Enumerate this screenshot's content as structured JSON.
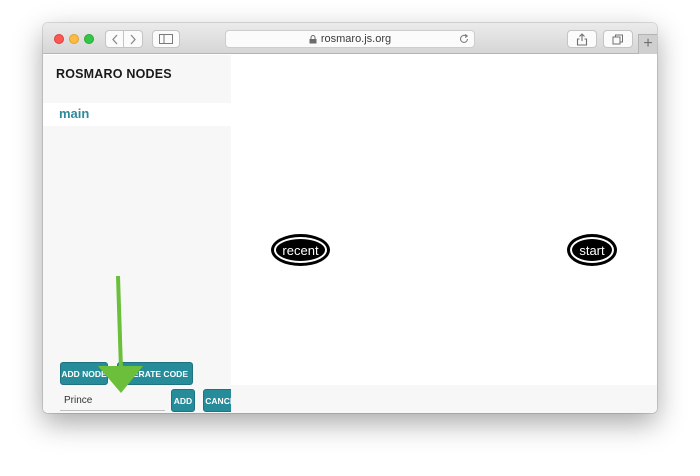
{
  "browser": {
    "url": "rosmaro.js.org"
  },
  "sidebar": {
    "title": "ROSMARO NODES",
    "items": [
      {
        "label": "main"
      }
    ]
  },
  "actions": {
    "add_node_label": "ADD NODE",
    "generate_code_label": "GENERATE CODE",
    "add_label": "ADD",
    "cancel_label": "CANCEL"
  },
  "form": {
    "node_name_value": "Prince"
  },
  "graph": {
    "nodes": [
      {
        "label": "recent"
      },
      {
        "label": "start"
      }
    ]
  },
  "colors": {
    "accent": "#268c9a",
    "link": "#2e8a9e",
    "annotation_arrow": "#6bbf3b"
  }
}
